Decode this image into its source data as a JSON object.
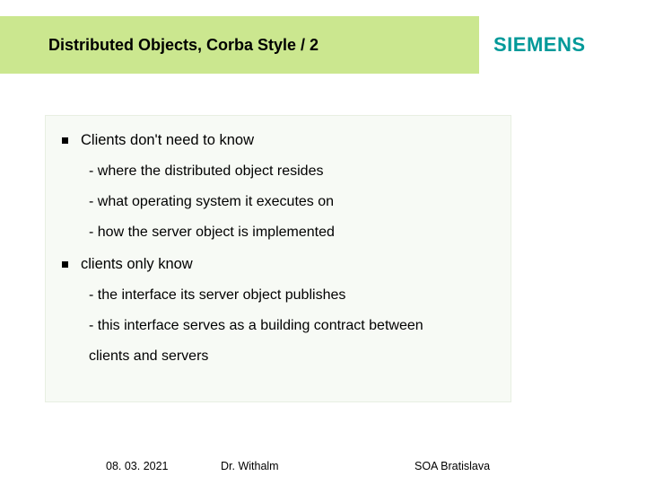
{
  "header": {
    "title": "Distributed Objects, Corba Style / 2",
    "brand": "SIEMENS"
  },
  "content": {
    "bullets": [
      {
        "text": "Clients don't need to know",
        "subs": [
          "- where the distributed object resides",
          "- what operating system it executes on",
          "- how the server object is implemented"
        ]
      },
      {
        "text": "clients only know",
        "subs": [
          "- the interface its server object publishes",
          "- this interface serves as a building contract between",
          "  clients and servers"
        ]
      }
    ]
  },
  "footer": {
    "date": "08. 03. 2021",
    "author": "Dr. Withalm",
    "event": "SOA Bratislava"
  }
}
